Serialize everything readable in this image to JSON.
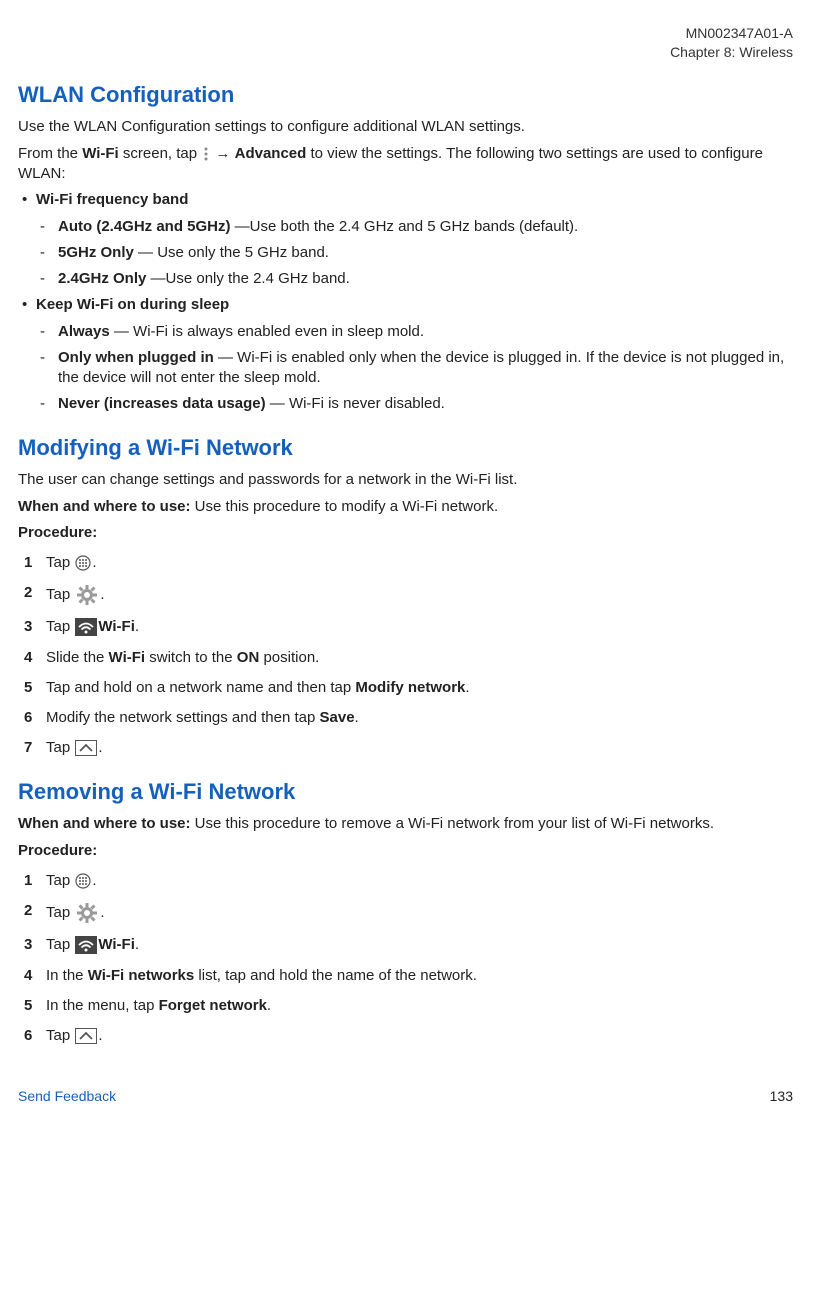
{
  "header": {
    "doc_id": "MN002347A01-A",
    "chapter": "Chapter 8:  Wireless"
  },
  "section1": {
    "title": "WLAN Configuration",
    "intro": "Use the WLAN Configuration settings to configure additional WLAN settings.",
    "nav_pre": "From the ",
    "nav_b1": "Wi-Fi",
    "nav_mid1": " screen, tap ",
    "nav_arrow": " → ",
    "nav_b2": "Advanced",
    "nav_post": " to view the settings. The following two settings are used to configure WLAN:",
    "bul1_label": "Wi-Fi frequency band",
    "bul1_a_b": "Auto (2.4GHz and 5GHz)",
    "bul1_a_t": " —Use both the 2.4 GHz and 5 GHz bands (default).",
    "bul1_b_b": "5GHz Only",
    "bul1_b_t": " — Use only the 5 GHz band.",
    "bul1_c_b": "2.4GHz Only",
    "bul1_c_t": " —Use only the 2.4 GHz band.",
    "bul2_label": "Keep Wi-Fi on during sleep",
    "bul2_a_b": "Always",
    "bul2_a_t": " — Wi-Fi is always enabled even in sleep mold.",
    "bul2_b_b": "Only when plugged in",
    "bul2_b_t": " — Wi-Fi is enabled only when the device is plugged in. If the device is not plugged in, the device will not enter the sleep mold.",
    "bul2_c_b": "Never (increases data usage)",
    "bul2_c_t": " — Wi-Fi is never disabled."
  },
  "section2": {
    "title": "Modifying a Wi-Fi Network",
    "intro": "The user can change settings and passwords for a network in the Wi-Fi list.",
    "when_label": "When and where to use:",
    "when_text": " Use this procedure to modify a Wi-Fi network.",
    "procedure_label": "Procedure:",
    "steps": {
      "s1_pre": "Tap ",
      "s1_post": ".",
      "s2_pre": "Tap ",
      "s2_post": ".",
      "s3_pre": "Tap ",
      "s3_b": "Wi-Fi",
      "s3_post": ".",
      "s4_pre": "Slide the ",
      "s4_b1": "Wi-Fi",
      "s4_mid": " switch to the ",
      "s4_b2": "ON",
      "s4_post": " position.",
      "s5_pre": "Tap and hold on a network name and then tap ",
      "s5_b": "Modify network",
      "s5_post": ".",
      "s6_pre": "Modify the network settings and then tap ",
      "s6_b": "Save",
      "s6_post": ".",
      "s7_pre": "Tap ",
      "s7_post": "."
    }
  },
  "section3": {
    "title": "Removing a Wi-Fi Network",
    "when_label": "When and where to use:",
    "when_text": " Use this procedure to remove a Wi-Fi network from your list of Wi-Fi networks.",
    "procedure_label": "Procedure:",
    "steps": {
      "s1_pre": "Tap ",
      "s1_post": ".",
      "s2_pre": "Tap ",
      "s2_post": ".",
      "s3_pre": "Tap ",
      "s3_b": "Wi-Fi",
      "s3_post": ".",
      "s4_pre": "In the ",
      "s4_b": "Wi-Fi networks",
      "s4_post": " list, tap and hold the name of the network.",
      "s5_pre": "In the menu, tap ",
      "s5_b": "Forget network",
      "s5_post": ".",
      "s6_pre": "Tap ",
      "s6_post": "."
    }
  },
  "footer": {
    "feedback": "Send Feedback",
    "page": "133"
  }
}
